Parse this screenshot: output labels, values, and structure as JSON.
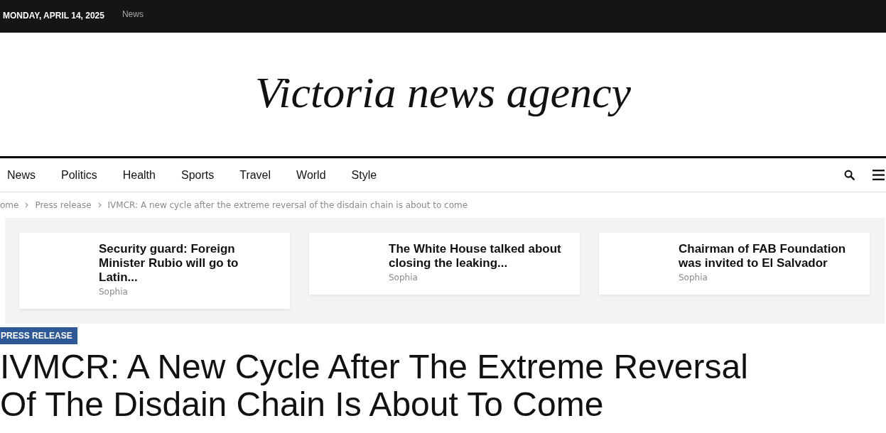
{
  "top_bar": {
    "date": "MONDAY, APRIL 14, 2025",
    "links": [
      "News"
    ]
  },
  "logo": {
    "text": "Victoria news agency"
  },
  "nav": {
    "items": [
      "News",
      "Politics",
      "Health",
      "Sports",
      "Travel",
      "World",
      "Style"
    ]
  },
  "breadcrumb": {
    "links": [
      "ome",
      "Press release"
    ],
    "current": "IVMCR: A new cycle after the extreme reversal of the disdain chain is about to come"
  },
  "featured": [
    {
      "title": "Security guard: Foreign Minister Rubio will go to Latin...",
      "author": "Sophia"
    },
    {
      "title": "The White House talked about closing the leaking...",
      "author": "Sophia"
    },
    {
      "title": "Chairman of FAB Foundation was invited to El Salvador",
      "author": "Sophia"
    }
  ],
  "article": {
    "category": "PRESS RELEASE",
    "title": "IVMCR: A New Cycle After The Extreme Reversal Of The Disdain Chain Is About To Come"
  }
}
